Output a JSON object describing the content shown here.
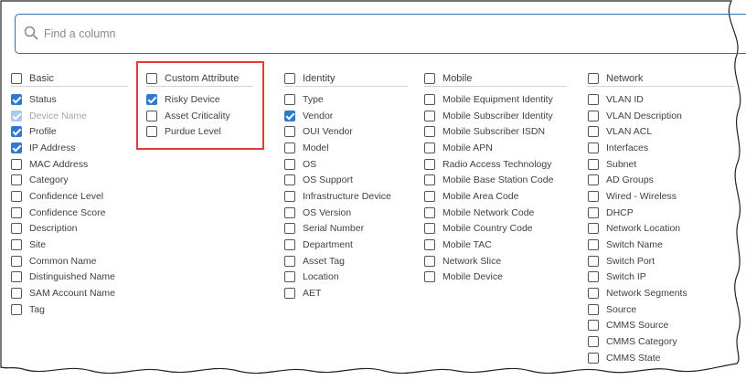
{
  "search": {
    "placeholder": "Find a column"
  },
  "columns": [
    {
      "header": "Basic",
      "items": [
        {
          "label": "Status",
          "checked": true
        },
        {
          "label": "Device Name",
          "checked": true,
          "disabled": true
        },
        {
          "label": "Profile",
          "checked": true
        },
        {
          "label": "IP Address",
          "checked": true
        },
        {
          "label": "MAC Address",
          "checked": false
        },
        {
          "label": "Category",
          "checked": false
        },
        {
          "label": "Confidence Level",
          "checked": false
        },
        {
          "label": "Confidence Score",
          "checked": false
        },
        {
          "label": "Description",
          "checked": false
        },
        {
          "label": "Site",
          "checked": false
        },
        {
          "label": "Common Name",
          "checked": false
        },
        {
          "label": "Distinguished Name",
          "checked": false
        },
        {
          "label": "SAM Account Name",
          "checked": false
        },
        {
          "label": "Tag",
          "checked": false
        }
      ]
    },
    {
      "header": "Custom Attribute",
      "items": [
        {
          "label": "Risky Device",
          "checked": true
        },
        {
          "label": "Asset Criticality",
          "checked": false
        },
        {
          "label": "Purdue Level",
          "checked": false
        }
      ]
    },
    {
      "header": "Identity",
      "items": [
        {
          "label": "Type",
          "checked": false
        },
        {
          "label": "Vendor",
          "checked": true
        },
        {
          "label": "OUI Vendor",
          "checked": false
        },
        {
          "label": "Model",
          "checked": false
        },
        {
          "label": "OS",
          "checked": false
        },
        {
          "label": "OS Support",
          "checked": false
        },
        {
          "label": "Infrastructure Device",
          "checked": false
        },
        {
          "label": "OS Version",
          "checked": false
        },
        {
          "label": "Serial Number",
          "checked": false
        },
        {
          "label": "Department",
          "checked": false
        },
        {
          "label": "Asset Tag",
          "checked": false
        },
        {
          "label": "Location",
          "checked": false
        },
        {
          "label": "AET",
          "checked": false
        }
      ]
    },
    {
      "header": "Mobile",
      "items": [
        {
          "label": "Mobile Equipment Identity",
          "checked": false
        },
        {
          "label": "Mobile Subscriber Identity",
          "checked": false
        },
        {
          "label": "Mobile Subscriber ISDN",
          "checked": false
        },
        {
          "label": "Mobile APN",
          "checked": false
        },
        {
          "label": "Radio Access Technology",
          "checked": false
        },
        {
          "label": "Mobile Base Station Code",
          "checked": false
        },
        {
          "label": "Mobile Area Code",
          "checked": false
        },
        {
          "label": "Mobile Network Code",
          "checked": false
        },
        {
          "label": "Mobile Country Code",
          "checked": false
        },
        {
          "label": "Mobile TAC",
          "checked": false
        },
        {
          "label": "Network Slice",
          "checked": false
        },
        {
          "label": "Mobile Device",
          "checked": false
        }
      ]
    },
    {
      "header": "Network",
      "items": [
        {
          "label": "VLAN ID",
          "checked": false
        },
        {
          "label": "VLAN Description",
          "checked": false
        },
        {
          "label": "VLAN ACL",
          "checked": false
        },
        {
          "label": "Interfaces",
          "checked": false
        },
        {
          "label": "Subnet",
          "checked": false
        },
        {
          "label": "AD Groups",
          "checked": false
        },
        {
          "label": "Wired - Wireless",
          "checked": false
        },
        {
          "label": "DHCP",
          "checked": false
        },
        {
          "label": "Network Location",
          "checked": false
        },
        {
          "label": "Switch Name",
          "checked": false
        },
        {
          "label": "Switch Port",
          "checked": false
        },
        {
          "label": "Switch IP",
          "checked": false
        },
        {
          "label": "Network Segments",
          "checked": false
        },
        {
          "label": "Source",
          "checked": false
        },
        {
          "label": "CMMS Source",
          "checked": false
        },
        {
          "label": "CMMS Category",
          "checked": false
        },
        {
          "label": "CMMS State",
          "checked": false
        }
      ]
    }
  ],
  "colors": {
    "accent": "#2e7ad1",
    "highlight": "#e53935",
    "search_border": "#2d6fb0"
  }
}
